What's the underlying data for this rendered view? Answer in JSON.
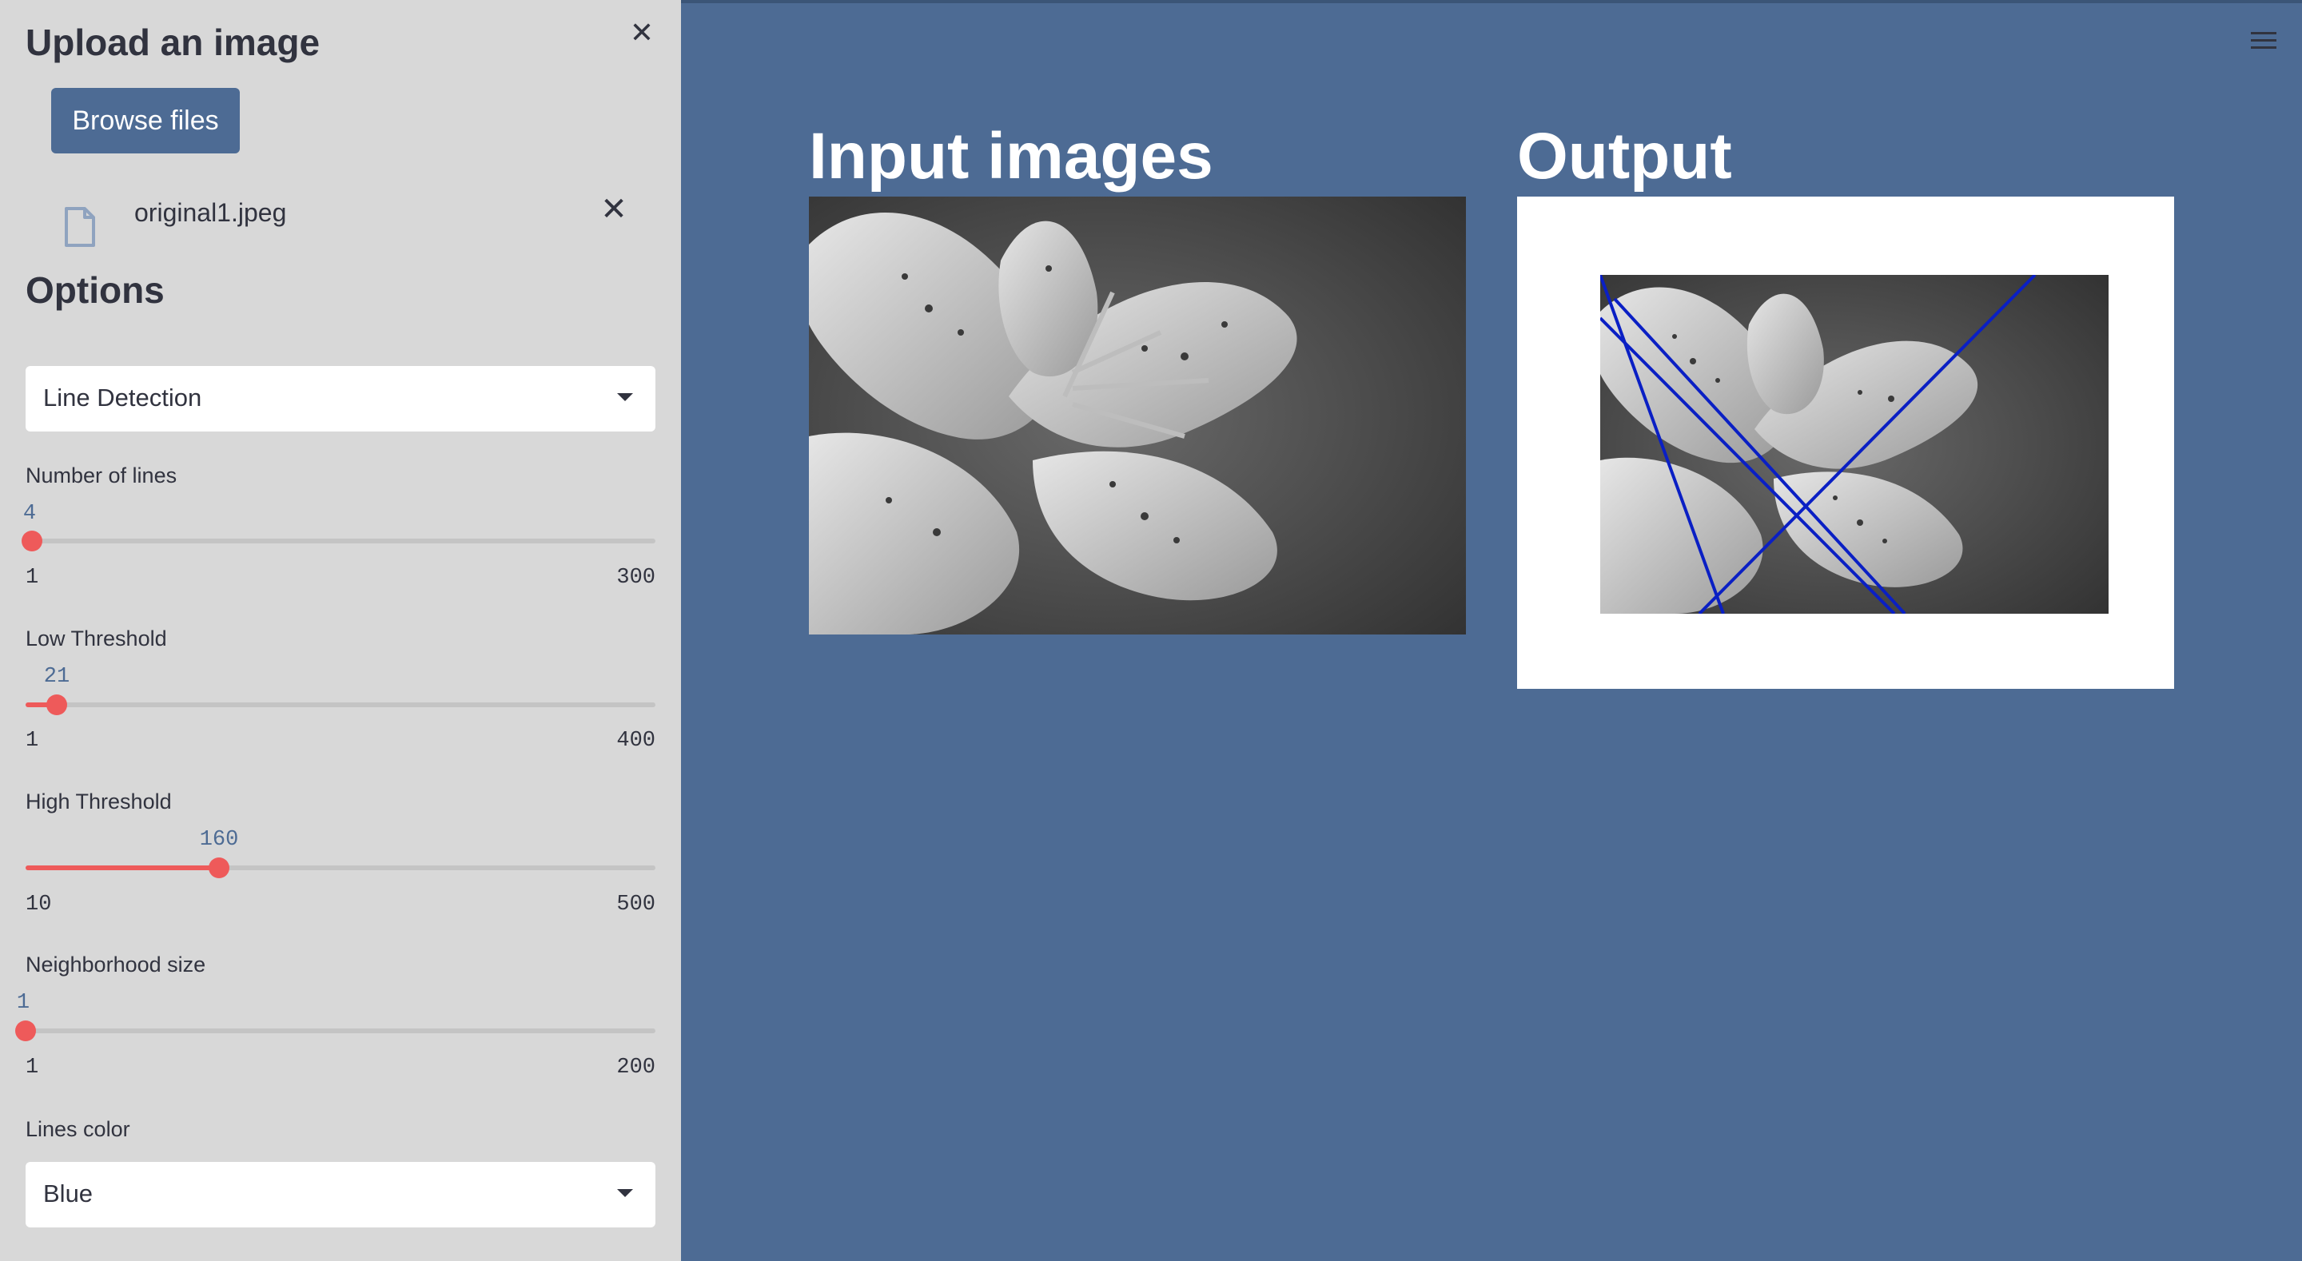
{
  "sidebar": {
    "title": "Upload an image",
    "browse_label": "Browse files",
    "file_name": "original1.jpeg",
    "options_title": "Options",
    "operation": "Line Detection",
    "sliders": {
      "lines": {
        "label": "Number of lines",
        "value": "4",
        "min": "1",
        "max": "300"
      },
      "low": {
        "label": "Low Threshold",
        "value": "21",
        "min": "1",
        "max": "400"
      },
      "high": {
        "label": "High Threshold",
        "value": "160",
        "min": "10",
        "max": "500"
      },
      "neighborhood": {
        "label": "Neighborhood size",
        "value": "1",
        "min": "1",
        "max": "200"
      }
    },
    "lines_color_label": "Lines color",
    "lines_color": "Blue"
  },
  "main": {
    "input_title": "Input images",
    "output_title": "Output"
  },
  "colors": {
    "accent": "#4d6b94",
    "slider": "#ee5a5a",
    "detected_lines": "#0a1fc4"
  }
}
